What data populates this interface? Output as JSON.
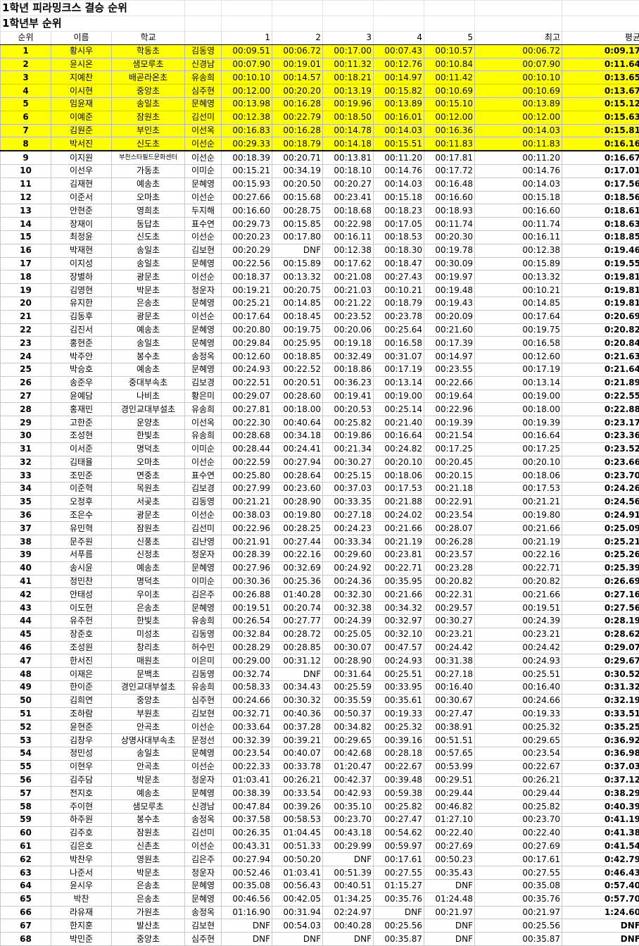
{
  "title": "1학년 피라밍크스 결승 순위",
  "subtitle": "1학년부 순위",
  "headers": [
    "순위",
    "이름",
    "학교",
    "",
    "1",
    "2",
    "3",
    "4",
    "5",
    "최고",
    "평균"
  ],
  "highlight_color": "#ffff00",
  "highlight_count": 8,
  "rows": [
    [
      "1",
      "황시우",
      "학동초",
      "김동영",
      "00:09.51",
      "00:06.72",
      "00:17.00",
      "00:07.43",
      "00:10.57",
      "00:06.72",
      "0:09.17"
    ],
    [
      "2",
      "윤시온",
      "샘모루초",
      "신경남",
      "00:07.90",
      "00:19.01",
      "00:11.32",
      "00:12.76",
      "00:10.84",
      "00:07.90",
      "0:11.64"
    ],
    [
      "3",
      "지예찬",
      "배곧라온초",
      "유송희",
      "00:10.10",
      "00:14.57",
      "00:18.21",
      "00:14.97",
      "00:11.42",
      "00:10.10",
      "0:13.65"
    ],
    [
      "4",
      "이시현",
      "중앙초",
      "심주현",
      "00:12.00",
      "00:20.20",
      "00:13.19",
      "00:15.82",
      "00:10.69",
      "00:10.69",
      "0:13.67"
    ],
    [
      "5",
      "임윤재",
      "송일초",
      "문혜영",
      "00:13.98",
      "00:16.28",
      "00:19.96",
      "00:13.89",
      "00:15.10",
      "00:13.89",
      "0:15.12"
    ],
    [
      "6",
      "이예준",
      "잠원초",
      "김선미",
      "00:12.38",
      "00:22.79",
      "00:18.50",
      "00:16.01",
      "00:12.00",
      "00:12.00",
      "0:15.63"
    ],
    [
      "7",
      "김원준",
      "부인초",
      "이선옥",
      "00:16.83",
      "00:16.28",
      "00:14.78",
      "00:14.03",
      "00:16.36",
      "00:14.03",
      "0:15.81"
    ],
    [
      "8",
      "박서진",
      "신도초",
      "이선순",
      "00:29.33",
      "00:18.79",
      "00:14.18",
      "00:15.51",
      "00:11.83",
      "00:11.83",
      "0:16.16"
    ],
    [
      "9",
      "이지원",
      "부천스타필드문화센터",
      "이선순",
      "00:18.39",
      "00:20.71",
      "00:13.81",
      "00:11.20",
      "00:17.81",
      "00:11.20",
      "0:16.67"
    ],
    [
      "10",
      "이선우",
      "가동초",
      "이미순",
      "00:15.21",
      "00:34.19",
      "00:18.10",
      "00:14.76",
      "00:17.72",
      "00:14.76",
      "0:17.01"
    ],
    [
      "11",
      "김재현",
      "예송초",
      "문혜영",
      "00:15.93",
      "00:20.50",
      "00:20.27",
      "00:14.03",
      "00:16.48",
      "00:14.03",
      "0:17.56"
    ],
    [
      "12",
      "이준서",
      "오마초",
      "이선순",
      "00:27.66",
      "00:15.68",
      "00:23.41",
      "00:15.18",
      "00:16.60",
      "00:15.18",
      "0:18.56"
    ],
    [
      "13",
      "안현준",
      "영희초",
      "두지해",
      "00:16.60",
      "00:28.75",
      "00:18.68",
      "00:18.23",
      "00:18.93",
      "00:16.60",
      "0:18.61"
    ],
    [
      "14",
      "장재이",
      "동답초",
      "표수연",
      "00:29.73",
      "00:15.85",
      "00:22.98",
      "00:17.05",
      "00:11.74",
      "00:11.74",
      "0:18.63"
    ],
    [
      "15",
      "최정윤",
      "신도초",
      "이선순",
      "00:20.23",
      "00:17.80",
      "00:16.11",
      "00:18.53",
      "00:20.30",
      "00:16.11",
      "0:18.85"
    ],
    [
      "16",
      "박재현",
      "송일초",
      "김보현",
      "00:20.29",
      "DNF",
      "00:12.38",
      "00:18.30",
      "00:19.78",
      "00:12.38",
      "0:19.46"
    ],
    [
      "17",
      "이지성",
      "송일초",
      "문혜영",
      "00:22.56",
      "00:15.89",
      "00:17.62",
      "00:18.47",
      "00:30.09",
      "00:15.89",
      "0:19.55"
    ],
    [
      "18",
      "장별하",
      "광문초",
      "이선순",
      "00:18.37",
      "00:13.32",
      "00:21.08",
      "00:27.43",
      "00:19.97",
      "00:13.32",
      "0:19.81"
    ],
    [
      "19",
      "김영현",
      "박문초",
      "정운자",
      "00:19.21",
      "00:20.75",
      "00:21.03",
      "00:10.21",
      "00:19.48",
      "00:10.21",
      "0:19.81"
    ],
    [
      "20",
      "유지한",
      "은송초",
      "문혜영",
      "00:25.21",
      "00:14.85",
      "00:21.22",
      "00:18.79",
      "00:19.43",
      "00:14.85",
      "0:19.81"
    ],
    [
      "21",
      "김동후",
      "광문초",
      "이선순",
      "00:17.64",
      "00:18.45",
      "00:23.52",
      "00:23.78",
      "00:20.09",
      "00:17.64",
      "0:20.69"
    ],
    [
      "22",
      "김진서",
      "예송초",
      "문혜영",
      "00:20.80",
      "00:19.75",
      "00:20.06",
      "00:25.64",
      "00:21.60",
      "00:19.75",
      "0:20.82"
    ],
    [
      "23",
      "홍현준",
      "송일초",
      "문혜영",
      "00:29.84",
      "00:25.95",
      "00:19.18",
      "00:16.58",
      "00:17.39",
      "00:16.58",
      "0:20.84"
    ],
    [
      "24",
      "박주안",
      "봉수초",
      "송정옥",
      "00:12.60",
      "00:18.85",
      "00:32.49",
      "00:31.07",
      "00:14.97",
      "00:12.60",
      "0:21.63"
    ],
    [
      "25",
      "박승호",
      "예송초",
      "문혜영",
      "00:24.93",
      "00:22.52",
      "00:18.86",
      "00:17.19",
      "00:23.55",
      "00:17.19",
      "0:21.64"
    ],
    [
      "26",
      "송준우",
      "중대부속초",
      "김보경",
      "00:22.51",
      "00:20.51",
      "00:36.23",
      "00:13.14",
      "00:22.66",
      "00:13.14",
      "0:21.89"
    ],
    [
      "27",
      "윤예담",
      "나비초",
      "황은미",
      "00:29.07",
      "00:28.60",
      "00:19.41",
      "00:19.00",
      "00:19.64",
      "00:19.00",
      "0:22.55"
    ],
    [
      "28",
      "홍재민",
      "경인교대부설초",
      "유송희",
      "00:27.81",
      "00:18.00",
      "00:20.53",
      "00:25.14",
      "00:22.96",
      "00:18.00",
      "0:22.88"
    ],
    [
      "29",
      "고한준",
      "운양초",
      "이선옥",
      "00:22.30",
      "00:40.64",
      "00:25.82",
      "00:21.40",
      "00:19.39",
      "00:19.39",
      "0:23.17"
    ],
    [
      "30",
      "조성현",
      "한빛초",
      "유송희",
      "00:28.68",
      "00:34.18",
      "00:19.86",
      "00:16.64",
      "00:21.54",
      "00:16.64",
      "0:23.36"
    ],
    [
      "31",
      "이서준",
      "명덕초",
      "이미순",
      "00:28.44",
      "00:24.41",
      "00:21.34",
      "00:24.82",
      "00:17.25",
      "00:17.25",
      "0:23.52"
    ],
    [
      "32",
      "김태율",
      "오마초",
      "이선순",
      "00:22.59",
      "00:27.94",
      "00:30.27",
      "00:20.10",
      "00:20.45",
      "00:20.10",
      "0:23.66"
    ],
    [
      "33",
      "조민준",
      "면중초",
      "표수연",
      "00:25.80",
      "00:28.64",
      "00:25.15",
      "00:18.06",
      "00:20.15",
      "00:18.06",
      "0:23.70"
    ],
    [
      "34",
      "이준혁",
      "목원초",
      "김보경",
      "00:27.99",
      "00:23.60",
      "00:37.03",
      "00:17.53",
      "00:21.18",
      "00:17.53",
      "0:24.26"
    ],
    [
      "35",
      "오정후",
      "서곶초",
      "김동영",
      "00:21.21",
      "00:28.90",
      "00:33.35",
      "00:21.88",
      "00:22.91",
      "00:21.21",
      "0:24.56"
    ],
    [
      "36",
      "조은수",
      "광문초",
      "이선순",
      "00:38.03",
      "00:19.80",
      "00:27.18",
      "00:24.02",
      "00:23.54",
      "00:19.80",
      "0:24.91"
    ],
    [
      "37",
      "유민혁",
      "잠원초",
      "김선미",
      "00:22.96",
      "00:28.25",
      "00:24.23",
      "00:21.66",
      "00:28.07",
      "00:21.66",
      "0:25.09"
    ],
    [
      "38",
      "문주원",
      "신풍초",
      "김난영",
      "00:21.91",
      "00:27.44",
      "00:33.34",
      "00:21.19",
      "00:26.28",
      "00:21.19",
      "0:25.21"
    ],
    [
      "39",
      "서푸름",
      "신정초",
      "정운자",
      "00:28.39",
      "00:22.16",
      "00:29.60",
      "00:23.81",
      "00:23.57",
      "00:22.16",
      "0:25.26"
    ],
    [
      "40",
      "송시윤",
      "예송초",
      "문혜영",
      "00:27.96",
      "00:32.69",
      "00:24.92",
      "00:22.71",
      "00:23.28",
      "00:22.71",
      "0:25.39"
    ],
    [
      "41",
      "정민찬",
      "명덕초",
      "이미순",
      "00:30.36",
      "00:25.36",
      "00:24.36",
      "00:35.95",
      "00:20.82",
      "00:20.82",
      "0:26.69"
    ],
    [
      "42",
      "안태성",
      "우이초",
      "김은주",
      "00:26.88",
      "01:40.28",
      "00:32.30",
      "00:21.66",
      "00:22.31",
      "00:21.66",
      "0:27.16"
    ],
    [
      "43",
      "이도헌",
      "은송초",
      "문혜영",
      "00:19.51",
      "00:20.74",
      "00:32.38",
      "00:34.32",
      "00:29.57",
      "00:19.51",
      "0:27.56"
    ],
    [
      "44",
      "유주헌",
      "한빛초",
      "유송희",
      "00:26.54",
      "00:27.77",
      "00:24.39",
      "00:32.97",
      "00:30.27",
      "00:24.39",
      "0:28.19"
    ],
    [
      "45",
      "장준호",
      "미성초",
      "김동영",
      "00:32.84",
      "00:28.72",
      "00:25.05",
      "00:32.10",
      "00:23.21",
      "00:23.21",
      "0:28.62"
    ],
    [
      "46",
      "조성원",
      "창리초",
      "허수민",
      "00:28.29",
      "00:28.85",
      "00:30.07",
      "00:47.57",
      "00:24.42",
      "00:24.42",
      "0:29.07"
    ],
    [
      "47",
      "한서진",
      "매원초",
      "이은미",
      "00:29.00",
      "00:31.12",
      "00:28.90",
      "00:24.93",
      "00:31.38",
      "00:24.93",
      "0:29.67"
    ],
    [
      "48",
      "이재은",
      "문백초",
      "김동영",
      "00:32.74",
      "DNF",
      "00:31.64",
      "00:25.51",
      "00:27.18",
      "00:25.51",
      "0:30.52"
    ],
    [
      "49",
      "한이준",
      "경인교대부설초",
      "유송희",
      "00:58.33",
      "00:34.43",
      "00:25.59",
      "00:33.95",
      "00:16.40",
      "00:16.40",
      "0:31.32"
    ],
    [
      "50",
      "김희연",
      "중앙초",
      "심주현",
      "00:24.66",
      "00:30.32",
      "00:35.59",
      "00:35.61",
      "00:30.67",
      "00:24.66",
      "0:32.19"
    ],
    [
      "51",
      "조하람",
      "부원초",
      "김보현",
      "00:32.71",
      "00:40.36",
      "00:50.37",
      "00:19.33",
      "00:27.47",
      "00:19.33",
      "0:33.51"
    ],
    [
      "52",
      "윤현준",
      "안곡초",
      "이선순",
      "00:33.64",
      "00:37.28",
      "00:34.82",
      "00:25.32",
      "00:38.91",
      "00:25.32",
      "0:35.25"
    ],
    [
      "53",
      "김창우",
      "상명사대부속초",
      "문정선",
      "00:32.39",
      "00:39.21",
      "00:29.65",
      "00:39.16",
      "00:51.51",
      "00:29.65",
      "0:36.92"
    ],
    [
      "54",
      "정민성",
      "송일초",
      "문혜영",
      "00:23.54",
      "00:40.07",
      "00:42.68",
      "00:28.18",
      "00:57.65",
      "00:23.54",
      "0:36.98"
    ],
    [
      "55",
      "이현우",
      "안곡초",
      "이선순",
      "00:22.33",
      "00:33.78",
      "01:20.47",
      "00:22.67",
      "00:53.99",
      "00:22.67",
      "0:37.03"
    ],
    [
      "56",
      "김주담",
      "박문초",
      "정운자",
      "01:03.41",
      "00:26.21",
      "00:42.37",
      "00:39.48",
      "00:29.51",
      "00:26.21",
      "0:37.12"
    ],
    [
      "57",
      "전지호",
      "예송초",
      "문혜영",
      "00:38.39",
      "00:33.54",
      "00:42.93",
      "00:59.38",
      "00:29.44",
      "00:29.44",
      "0:38.29"
    ],
    [
      "58",
      "주이현",
      "샘모루초",
      "신경남",
      "00:47.84",
      "00:39.26",
      "00:35.10",
      "00:25.82",
      "00:46.82",
      "00:25.82",
      "0:40.39"
    ],
    [
      "59",
      "하주원",
      "봉수초",
      "송정옥",
      "00:37.58",
      "00:58.53",
      "00:23.70",
      "00:27.47",
      "01:27.10",
      "00:23.70",
      "0:41.19"
    ],
    [
      "60",
      "김주호",
      "잠원초",
      "김선미",
      "00:26.35",
      "01:04.45",
      "00:43.18",
      "00:54.62",
      "00:22.40",
      "00:22.40",
      "0:41.38"
    ],
    [
      "61",
      "김은호",
      "신촌초",
      "이선순",
      "00:43.31",
      "00:51.33",
      "00:29.99",
      "00:59.97",
      "00:27.69",
      "00:27.69",
      "0:41.54"
    ],
    [
      "62",
      "박찬우",
      "영원초",
      "김은주",
      "00:27.94",
      "00:50.20",
      "DNF",
      "00:17.61",
      "00:50.23",
      "00:17.61",
      "0:42.79"
    ],
    [
      "63",
      "나준서",
      "박문초",
      "정운자",
      "00:52.46",
      "01:03.41",
      "00:51.39",
      "00:27.55",
      "00:35.43",
      "00:27.55",
      "0:46.43"
    ],
    [
      "64",
      "윤시우",
      "은송초",
      "문혜영",
      "00:35.08",
      "00:56.43",
      "00:40.51",
      "01:15.27",
      "DNF",
      "00:35.08",
      "0:57.40"
    ],
    [
      "65",
      "박찬",
      "은송초",
      "문혜영",
      "00:46.56",
      "00:42.05",
      "01:34.25",
      "00:35.76",
      "01:24.48",
      "00:35.76",
      "0:57.70"
    ],
    [
      "66",
      "라유재",
      "가원초",
      "송정옥",
      "01:16.90",
      "00:31.94",
      "02:24.97",
      "DNF",
      "00:21.97",
      "00:21.97",
      "1:24.60"
    ],
    [
      "67",
      "한지훈",
      "발산초",
      "김보현",
      "DNF",
      "00:54.03",
      "00:40.28",
      "00:25.56",
      "DNF",
      "00:25.56",
      "DNF"
    ],
    [
      "68",
      "박민준",
      "중앙초",
      "심주현",
      "DNF",
      "DNF",
      "DNF",
      "00:35.87",
      "DNF",
      "00:35.87",
      "DNF"
    ]
  ]
}
